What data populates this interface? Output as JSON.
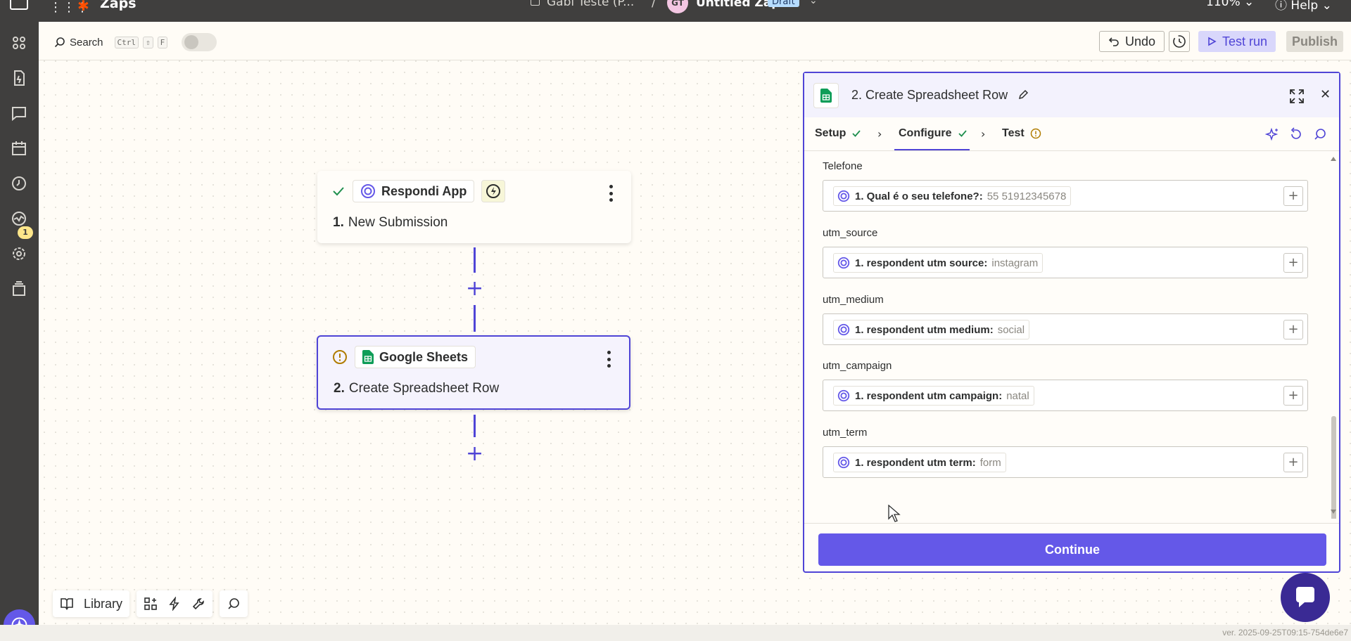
{
  "topbar": {
    "app_name": "Zaps",
    "folder_name": "Gabi Teste (P...",
    "separator": "/",
    "avatar_initials": "GT",
    "zap_name": "Untitled Zap",
    "status_badge": "Draft",
    "zoom": "110%",
    "help": "Help"
  },
  "sidebar": {
    "items": [
      "apps-icon",
      "zap-doc-icon",
      "chat-icon",
      "calendar-icon",
      "history-icon",
      "activity-icon",
      "settings-icon",
      "layers-icon"
    ],
    "badge_count": "1"
  },
  "toolbar": {
    "search_label": "Search",
    "kbd_ctrl": "Ctrl",
    "kbd_shift": "⇧",
    "kbd_f": "F",
    "undo": "Undo",
    "test_run": "Test run",
    "publish": "Publish"
  },
  "steps": [
    {
      "app": "Respondi App",
      "number": "1.",
      "title": "New Submission",
      "status": "complete"
    },
    {
      "app": "Google Sheets",
      "number": "2.",
      "title": "Create Spreadsheet Row",
      "status": "warning"
    }
  ],
  "bottom_toolbar": {
    "library": "Library"
  },
  "panel": {
    "title": "2. Create Spreadsheet Row",
    "tabs": [
      {
        "label": "Setup",
        "status": "complete"
      },
      {
        "label": "Configure",
        "status": "complete"
      },
      {
        "label": "Test",
        "status": "warning"
      }
    ],
    "fields": [
      {
        "label": "Telefone",
        "key": "1. Qual é o seu telefone?:",
        "value": "55 51912345678"
      },
      {
        "label": "utm_source",
        "key": "1. respondent utm source:",
        "value": "instagram"
      },
      {
        "label": "utm_medium",
        "key": "1. respondent utm medium:",
        "value": "social"
      },
      {
        "label": "utm_campaign",
        "key": "1. respondent utm campaign:",
        "value": "natal"
      },
      {
        "label": "utm_term",
        "key": "1. respondent utm term:",
        "value": "form"
      }
    ],
    "continue": "Continue"
  },
  "footer": {
    "version": "ver. 2025-09-25T09:15-754de6e7"
  },
  "colors": {
    "accent": "#4f44d6",
    "primary_button": "#6458e8",
    "zapier_orange": "#ff4f00",
    "sheets_green": "#0f9d58",
    "success": "#1f8f4e",
    "warning": "#b07c00"
  }
}
